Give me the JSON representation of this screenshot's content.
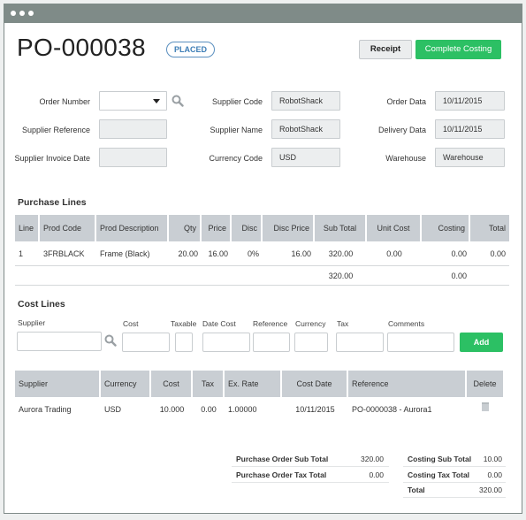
{
  "header": {
    "po_number": "PO-000038",
    "status": "PLACED",
    "receipt_label": "Receipt",
    "complete_costing_label": "Complete Costing"
  },
  "colors": {
    "accent_green": "#2cc064",
    "status_blue": "#3c7db6",
    "titlebar": "#7f8b88",
    "table_header": "#c9ced3"
  },
  "form": {
    "order_number": {
      "label": "Order Number",
      "value": ""
    },
    "supplier_reference": {
      "label": "Supplier Reference",
      "value": ""
    },
    "supplier_invoice_date": {
      "label": "Supplier Invoice Date",
      "value": ""
    },
    "supplier_code": {
      "label": "Supplier Code",
      "value": "RobotShack"
    },
    "supplier_name": {
      "label": "Supplier Name",
      "value": "RobotShack"
    },
    "currency_code": {
      "label": "Currency Code",
      "value": "USD"
    },
    "order_date": {
      "label": "Order Data",
      "value": "10/11/2015"
    },
    "delivery_date": {
      "label": "Delivery Data",
      "value": "10/11/2015"
    },
    "warehouse": {
      "label": "Warehouse",
      "value": "Warehouse"
    }
  },
  "purchase_lines": {
    "title": "Purchase Lines",
    "columns": [
      "Line",
      "Prod Code",
      "Prod Description",
      "Qty",
      "Price",
      "Disc",
      "Disc Price",
      "Sub Total",
      "Unit Cost",
      "Costing",
      "Total"
    ],
    "rows": [
      [
        "1",
        "3FRBLACK",
        "Frame (Black)",
        "20.00",
        "16.00",
        "0%",
        "16.00",
        "320.00",
        "0.00",
        "0.00",
        "0.00"
      ]
    ],
    "totals": {
      "sub_total": "320.00",
      "costing": "0.00"
    }
  },
  "cost_lines": {
    "title": "Cost Lines",
    "fields": {
      "supplier": "Supplier",
      "cost": "Cost",
      "taxable": "Taxable",
      "date_cost": "Date Cost",
      "reference": "Reference",
      "currency": "Currency",
      "tax": "Tax",
      "comments": "Comments"
    },
    "add_label": "Add",
    "columns": [
      "Supplier",
      "Currency",
      "Cost",
      "Tax",
      "Ex. Rate",
      "Cost Date",
      "Reference",
      "Delete"
    ],
    "rows": [
      [
        "Aurora Trading",
        "USD",
        "10.000",
        "0.00",
        "1.00000",
        "10/11/2015",
        "PO-0000038 - Aurora1"
      ]
    ]
  },
  "summary": {
    "po_sub_total_label": "Purchase Order Sub Total",
    "po_sub_total": "320.00",
    "po_tax_total_label": "Purchase Order Tax Total",
    "po_tax_total": "0.00",
    "costing_sub_total_label": "Costing Sub Total",
    "costing_sub_total": "10.00",
    "costing_tax_total_label": "Costing Tax Total",
    "costing_tax_total": "0.00",
    "total_label": "Total",
    "total": "320.00"
  }
}
